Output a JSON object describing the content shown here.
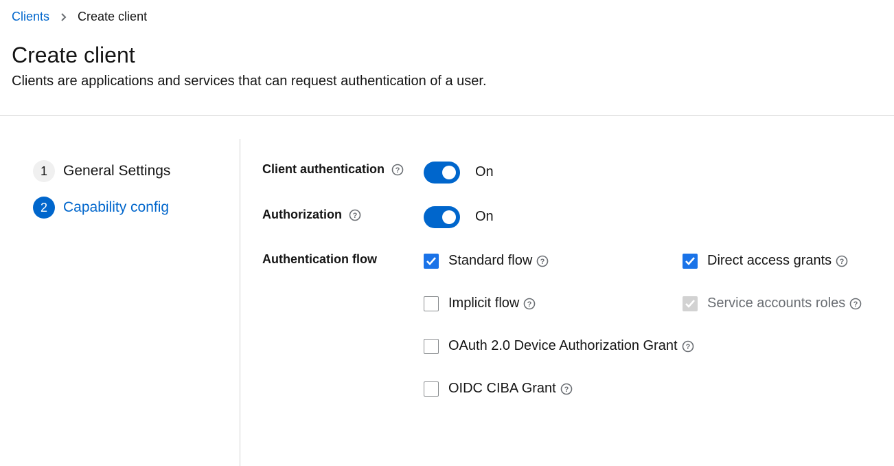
{
  "breadcrumb": {
    "parent": "Clients",
    "current": "Create client"
  },
  "header": {
    "title": "Create client",
    "description": "Clients are applications and services that can request authentication of a user."
  },
  "wizard": {
    "steps": [
      {
        "number": "1",
        "label": "General Settings",
        "active": false
      },
      {
        "number": "2",
        "label": "Capability config",
        "active": true
      }
    ]
  },
  "form": {
    "client_authentication": {
      "label": "Client authentication",
      "state_text": "On",
      "enabled": true
    },
    "authorization": {
      "label": "Authorization",
      "state_text": "On",
      "enabled": true
    },
    "authentication_flow": {
      "label": "Authentication flow",
      "options": [
        {
          "label": "Standard flow",
          "checked": true,
          "disabled": false
        },
        {
          "label": "Direct access grants",
          "checked": true,
          "disabled": false
        },
        {
          "label": "Implicit flow",
          "checked": false,
          "disabled": false
        },
        {
          "label": "Service accounts roles",
          "checked": true,
          "disabled": true
        },
        {
          "label": "OAuth 2.0 Device Authorization Grant",
          "checked": false,
          "disabled": false
        },
        {
          "label": "OIDC CIBA Grant",
          "checked": false,
          "disabled": false
        }
      ]
    }
  },
  "colors": {
    "accent": "#0066cc",
    "checkbox": "#1a73e8",
    "disabled": "#d2d2d2",
    "divider": "#d2d2d2"
  },
  "icons": {
    "help": "question-circle-icon",
    "separator": "chevron-right-icon",
    "check": "checkmark-icon"
  }
}
